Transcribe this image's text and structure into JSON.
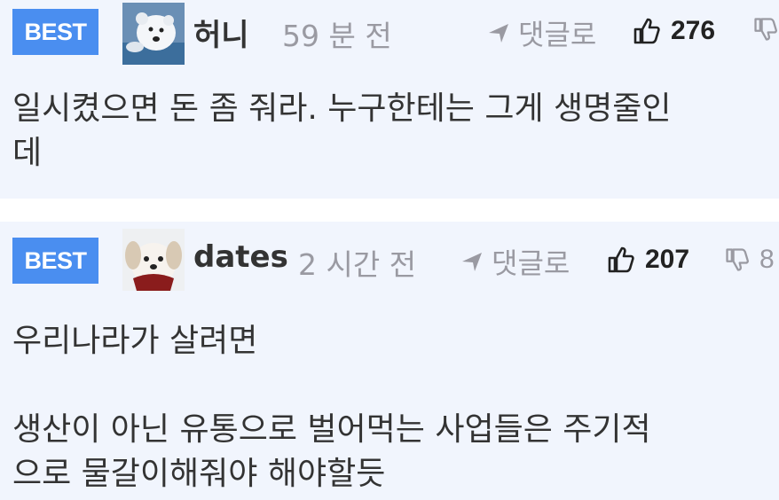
{
  "comments": [
    {
      "badge": "BEST",
      "author": "허니",
      "time": "59 분 전",
      "reply_label": "댓글로",
      "likes": "276",
      "dislikes": "",
      "avatar_icon": "polar-bear-avatar",
      "body_lines": [
        "일시켰으면 돈 좀 줘라. 누구한테는 그게 생명줄인",
        "데"
      ]
    },
    {
      "badge": "BEST",
      "author": "dates",
      "time": "2 시간 전",
      "reply_label": "댓글로",
      "likes": "207",
      "dislikes": "8",
      "avatar_icon": "puppy-avatar",
      "body_lines": [
        "우리나라가 살려면",
        "",
        "생산이 아닌 유통으로 벌어먹는 사업들은 주기적",
        "으로 물갈이해줘야 해야할듯"
      ]
    }
  ],
  "colors": {
    "badge": "#4a8ef0",
    "card_bg": "#f1f5fd",
    "muted": "#9a9aa2",
    "text": "#333333"
  },
  "icons": {
    "reply": "reply-arrow-icon",
    "like": "thumbs-up-icon",
    "dislike": "thumbs-down-icon"
  }
}
